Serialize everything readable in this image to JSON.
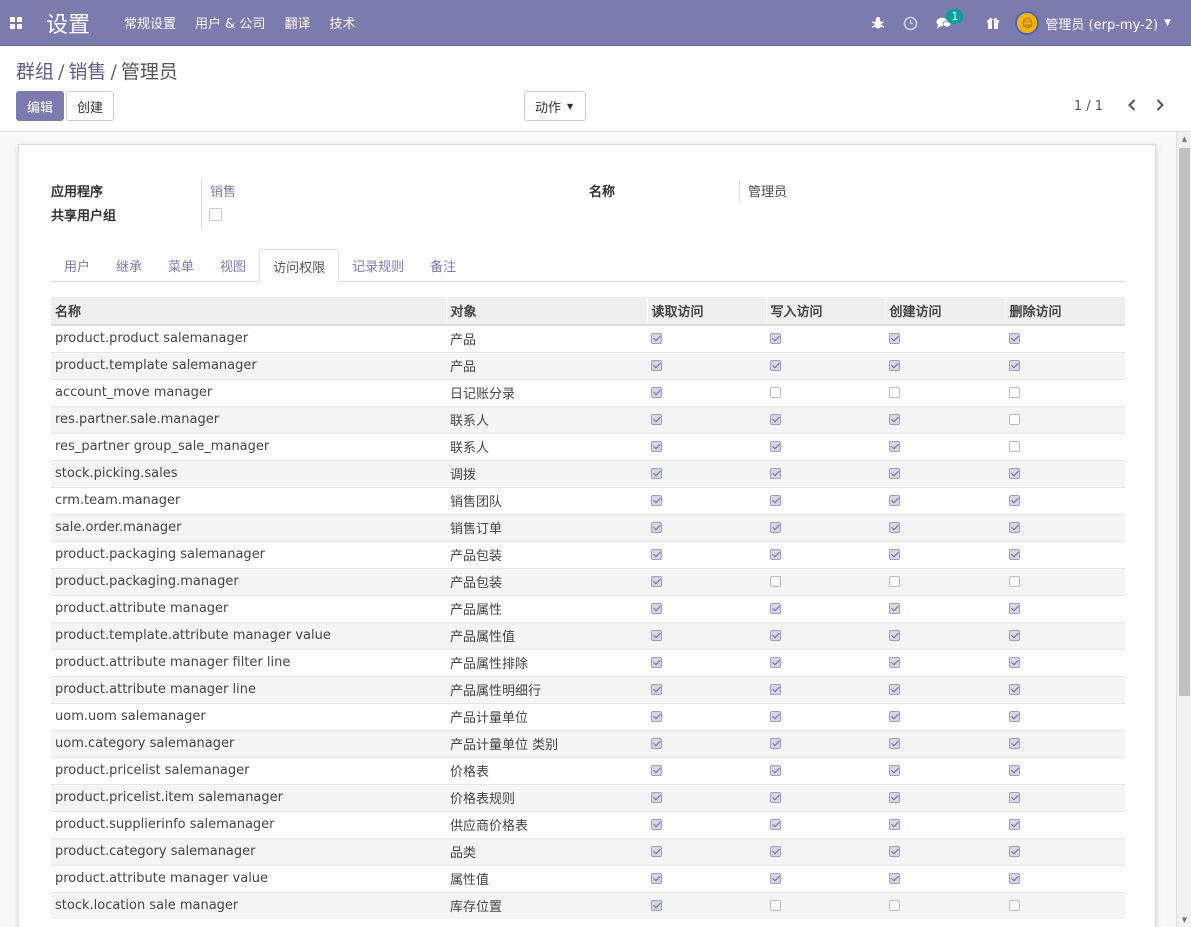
{
  "navbar": {
    "brand": "设置",
    "menu": [
      "常规设置",
      "用户 & 公司",
      "翻译",
      "技术"
    ],
    "messages_badge": "1",
    "user_name": "管理员 (erp-my-2)"
  },
  "control_panel": {
    "breadcrumb": [
      "群组",
      "销售",
      "管理员"
    ],
    "edit_label": "编辑",
    "create_label": "创建",
    "action_label": "动作",
    "pager": "1 / 1"
  },
  "form": {
    "application_label": "应用程序",
    "application_value": "销售",
    "shared_group_label": "共享用户组",
    "name_label": "名称",
    "name_value": "管理员"
  },
  "tabs": [
    {
      "label": "用户",
      "active": false
    },
    {
      "label": "继承",
      "active": false
    },
    {
      "label": "菜单",
      "active": false
    },
    {
      "label": "视图",
      "active": false
    },
    {
      "label": "访问权限",
      "active": true
    },
    {
      "label": "记录规则",
      "active": false
    },
    {
      "label": "备注",
      "active": false
    }
  ],
  "access_table": {
    "columns": [
      "名称",
      "对象",
      "读取访问",
      "写入访问",
      "创建访问",
      "删除访问"
    ],
    "rows": [
      {
        "name": "product.product salemanager",
        "object": "产品",
        "read": true,
        "write": true,
        "create": true,
        "unlink": true
      },
      {
        "name": "product.template salemanager",
        "object": "产品",
        "read": true,
        "write": true,
        "create": true,
        "unlink": true
      },
      {
        "name": "account_move manager",
        "object": "日记账分录",
        "read": true,
        "write": false,
        "create": false,
        "unlink": false
      },
      {
        "name": "res.partner.sale.manager",
        "object": "联系人",
        "read": true,
        "write": true,
        "create": true,
        "unlink": false
      },
      {
        "name": "res_partner group_sale_manager",
        "object": "联系人",
        "read": true,
        "write": true,
        "create": true,
        "unlink": false
      },
      {
        "name": "stock.picking.sales",
        "object": "调拨",
        "read": true,
        "write": true,
        "create": true,
        "unlink": true
      },
      {
        "name": "crm.team.manager",
        "object": "销售团队",
        "read": true,
        "write": true,
        "create": true,
        "unlink": true
      },
      {
        "name": "sale.order.manager",
        "object": "销售订单",
        "read": true,
        "write": true,
        "create": true,
        "unlink": true
      },
      {
        "name": "product.packaging salemanager",
        "object": "产品包装",
        "read": true,
        "write": true,
        "create": true,
        "unlink": true
      },
      {
        "name": "product.packaging.manager",
        "object": "产品包装",
        "read": true,
        "write": false,
        "create": false,
        "unlink": false
      },
      {
        "name": "product.attribute manager",
        "object": "产品属性",
        "read": true,
        "write": true,
        "create": true,
        "unlink": true
      },
      {
        "name": "product.template.attribute manager value",
        "object": "产品属性值",
        "read": true,
        "write": true,
        "create": true,
        "unlink": true
      },
      {
        "name": "product.attribute manager filter line",
        "object": "产品属性排除",
        "read": true,
        "write": true,
        "create": true,
        "unlink": true
      },
      {
        "name": "product.attribute manager line",
        "object": "产品属性明细行",
        "read": true,
        "write": true,
        "create": true,
        "unlink": true
      },
      {
        "name": "uom.uom salemanager",
        "object": "产品计量单位",
        "read": true,
        "write": true,
        "create": true,
        "unlink": true
      },
      {
        "name": "uom.category salemanager",
        "object": "产品计量单位 类别",
        "read": true,
        "write": true,
        "create": true,
        "unlink": true
      },
      {
        "name": "product.pricelist salemanager",
        "object": "价格表",
        "read": true,
        "write": true,
        "create": true,
        "unlink": true
      },
      {
        "name": "product.pricelist.item salemanager",
        "object": "价格表规则",
        "read": true,
        "write": true,
        "create": true,
        "unlink": true
      },
      {
        "name": "product.supplierinfo salemanager",
        "object": "供应商价格表",
        "read": true,
        "write": true,
        "create": true,
        "unlink": true
      },
      {
        "name": "product.category salemanager",
        "object": "品类",
        "read": true,
        "write": true,
        "create": true,
        "unlink": true
      },
      {
        "name": "product.attribute manager value",
        "object": "属性值",
        "read": true,
        "write": true,
        "create": true,
        "unlink": true
      },
      {
        "name": "stock.location sale manager",
        "object": "库存位置",
        "read": true,
        "write": false,
        "create": false,
        "unlink": false
      }
    ]
  }
}
